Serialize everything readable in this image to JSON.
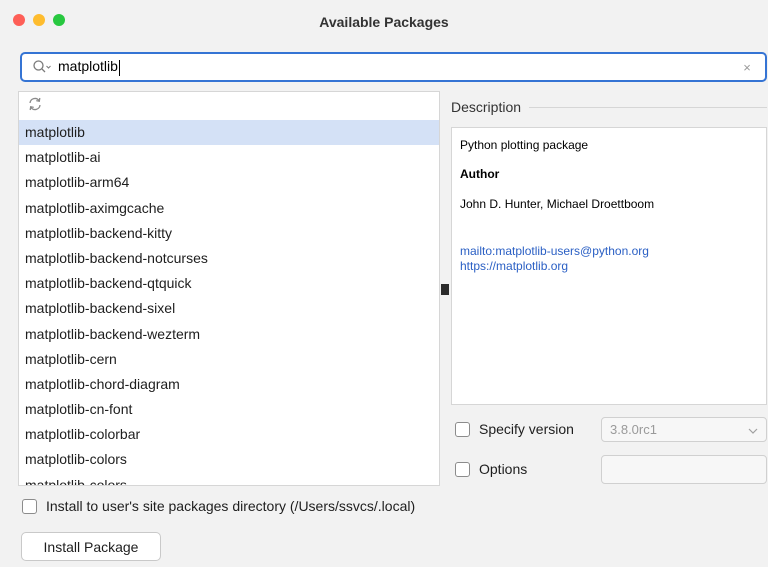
{
  "window": {
    "title": "Available Packages",
    "traffic_lights": {
      "close": "#fe5f57",
      "minimize": "#febc2e",
      "maximize": "#28c840"
    }
  },
  "search": {
    "value": "matplotlib",
    "icon": "search-icon",
    "clear_glyph": "×"
  },
  "list": {
    "refresh_icon": "refresh-icon",
    "items": [
      "matplotlib",
      "matplotlib-ai",
      "matplotlib-arm64",
      "matplotlib-aximgcache",
      "matplotlib-backend-kitty",
      "matplotlib-backend-notcurses",
      "matplotlib-backend-qtquick",
      "matplotlib-backend-sixel",
      "matplotlib-backend-wezterm",
      "matplotlib-cern",
      "matplotlib-chord-diagram",
      "matplotlib-cn-font",
      "matplotlib-colorbar",
      "matplotlib-colors",
      "matplotlib-colors"
    ],
    "selected_index": 0
  },
  "description": {
    "header": "Description",
    "summary": "Python plotting package",
    "author_heading": "Author",
    "author": "John D. Hunter, Michael Droettboom",
    "links": [
      "mailto:matplotlib-users@python.org",
      "https://matplotlib.org"
    ]
  },
  "version": {
    "label": "Specify version",
    "value": "3.8.0rc1",
    "checked": false
  },
  "options": {
    "label": "Options",
    "checked": false,
    "value": ""
  },
  "install_user": {
    "label": "Install to user's site packages directory (/Users/ssvcs/.local)",
    "checked": false
  },
  "install_button": {
    "label": "Install Package"
  },
  "colors": {
    "accent": "#3574d4",
    "selection": "#d4e1f6",
    "link": "#2a5fc4"
  }
}
